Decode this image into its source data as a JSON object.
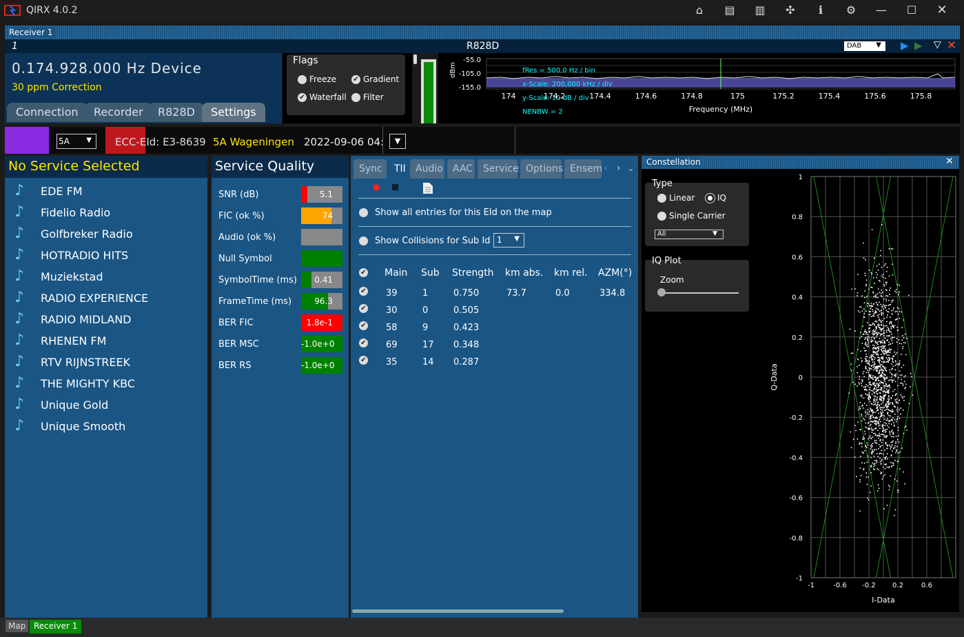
{
  "app": {
    "title": "QIRX 4.0.2"
  },
  "receiver_header": "Receiver 1",
  "device_bar": {
    "index": "1",
    "device_name": "R828D",
    "mode": "DAB"
  },
  "frequency": {
    "value": "0.174.928.000 Hz Device",
    "correction": "30 ppm Correction"
  },
  "tabs": [
    {
      "label": "Connection"
    },
    {
      "label": "Recorder"
    },
    {
      "label": "R828D"
    },
    {
      "label": "Settings"
    }
  ],
  "flags": {
    "title": "Flags",
    "freeze": "Freeze",
    "gradient": "Gradient",
    "waterfall": "Waterfall",
    "filter": "Filter"
  },
  "spectrum": {
    "ylabel": "dBm",
    "yticks": [
      "-55.0",
      "-105.0",
      "-155.0"
    ],
    "xticks": [
      "174",
      "174.2",
      "174.4",
      "174.6",
      "174.8",
      "175",
      "175.2",
      "175.4",
      "175.6",
      "175.8"
    ],
    "xlabel": "Frequency (MHz)",
    "info": [
      "fRes = 500,0 Hz / bin",
      "x-Scale: 200,000 kHz / div",
      "y-Scale: 10 dB / div",
      "NENBW = 2"
    ]
  },
  "info_bar": {
    "channel": "5A",
    "ecc": "ECC-EId: E3-8639",
    "ensemble": "5A Wageningen",
    "datetime": "2022-09-06 04:"
  },
  "services": {
    "title": "No Service Selected",
    "items": [
      "EDE FM",
      "Fidelio Radio",
      "Golfbreker Radio",
      "HOTRADIO HITS",
      "Muziekstad",
      "RADIO EXPERIENCE",
      "RADIO MIDLAND",
      "RHENEN FM",
      "RTV RIJNSTREEK",
      "THE MIGHTY KBC",
      "Unique Gold",
      "Unique Smooth"
    ]
  },
  "quality": {
    "title": "Service Quality",
    "rows": [
      {
        "label": "SNR (dB)",
        "value": "5.1",
        "fill": 0.15,
        "color": "#ff0000"
      },
      {
        "label": "FIC (ok %)",
        "value": "74",
        "fill": 0.74,
        "color": "#ffa500"
      },
      {
        "label": "Audio (ok %)",
        "value": "",
        "fill": 0,
        "color": "#888888"
      },
      {
        "label": "Null Symbol",
        "value": "",
        "fill": 1,
        "color": "#008000"
      },
      {
        "label": "SymbolTime (ms)",
        "value": "0.41",
        "fill": 0.25,
        "color": "#008000"
      },
      {
        "label": "FrameTime (ms)",
        "value": "96.3",
        "fill": 0.65,
        "color": "#008000"
      },
      {
        "label": "BER FIC",
        "value": "1.8e-1",
        "fill": 1,
        "color": "#ff0000"
      },
      {
        "label": "BER MSC",
        "value": "-1.0e+0",
        "fill": 1,
        "color": "#008000"
      },
      {
        "label": "BER RS",
        "value": "-1.0e+0",
        "fill": 1,
        "color": "#008000"
      }
    ]
  },
  "tii": {
    "tabs": [
      "Sync",
      "TII",
      "Audio",
      "AAC",
      "Service",
      "Options",
      "Ensemble"
    ],
    "show_all": "Show all entries for this EId on the map",
    "show_collisions": "Show Collisions for Sub Id",
    "collision_value": "1",
    "headers": [
      "Main",
      "Sub",
      "Strength",
      "km abs.",
      "km rel.",
      "AZM(°)"
    ],
    "rows": [
      [
        "39",
        "1",
        "0.750",
        "73.7",
        "0.0",
        "334.8"
      ],
      [
        "30",
        "0",
        "0.505",
        "",
        "",
        ""
      ],
      [
        "58",
        "9",
        "0.423",
        "",
        "",
        ""
      ],
      [
        "69",
        "17",
        "0.348",
        "",
        "",
        ""
      ],
      [
        "35",
        "14",
        "0.287",
        "",
        "",
        ""
      ]
    ]
  },
  "constellation": {
    "title": "Constellation",
    "type_title": "Type",
    "linear": "Linear",
    "iq": "IQ",
    "single_carrier": "Single Carrier",
    "carrier_select": "All",
    "iqplot_title": "IQ Plot",
    "zoom": "Zoom",
    "xlabel": "I-Data",
    "ylabel": "Q-Data",
    "yticks": [
      "1",
      "0.8",
      "0.6",
      "0.4",
      "0.2",
      "0",
      "-0.2",
      "-0.4",
      "-0.6",
      "-0.8",
      "-1"
    ],
    "xticks": [
      "-1",
      "-0.6",
      "-0.2",
      "0.2",
      "0.6"
    ]
  },
  "statusbar": {
    "map": "Map",
    "receiver": "Receiver 1"
  }
}
